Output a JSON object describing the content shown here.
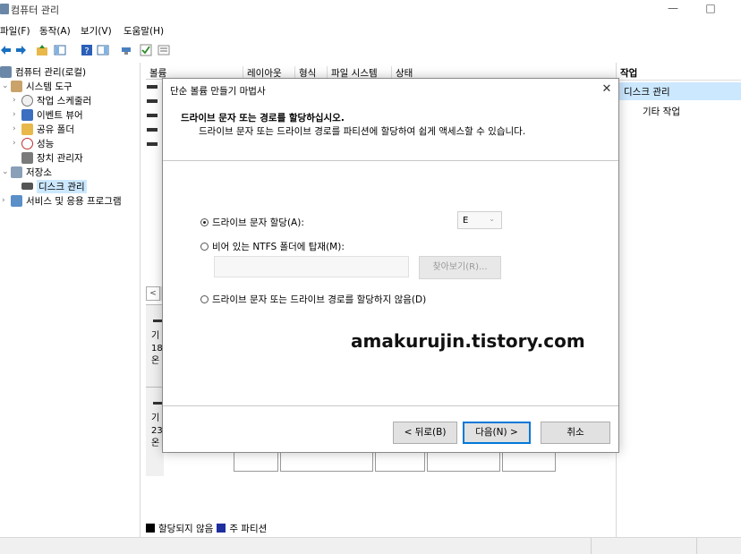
{
  "window": {
    "title": "컴퓨터 관리",
    "minimize_glyph": "—",
    "maximize_glyph": "□"
  },
  "menu": [
    "파일(F)",
    "동작(A)",
    "보기(V)",
    "도움말(H)"
  ],
  "toolbar_icons": [
    "back-arrow-icon",
    "forward-arrow-icon",
    "up-folder-icon",
    "console-tree-icon",
    "help-icon",
    "properties-icon",
    "connect-icon",
    "checkmark-icon",
    "grid-icon"
  ],
  "tree": [
    {
      "label": "컴퓨터 관리(로컬)",
      "icon": "computer-management-icon",
      "level": 0,
      "chevron": ""
    },
    {
      "label": "시스템 도구",
      "icon": "system-tools-icon",
      "level": 1,
      "chevron": "⌄"
    },
    {
      "label": "작업 스케줄러",
      "icon": "task-scheduler-icon",
      "level": 2,
      "chevron": "›"
    },
    {
      "label": "이벤트 뷰어",
      "icon": "event-viewer-icon",
      "level": 2,
      "chevron": "›"
    },
    {
      "label": "공유 폴더",
      "icon": "shared-folders-icon",
      "level": 2,
      "chevron": "›"
    },
    {
      "label": "성능",
      "icon": "performance-icon",
      "level": 2,
      "chevron": "›"
    },
    {
      "label": "장치 관리자",
      "icon": "device-manager-icon",
      "level": 2,
      "chevron": ""
    },
    {
      "label": "저장소",
      "icon": "storage-icon",
      "level": 1,
      "chevron": "⌄"
    },
    {
      "label": "디스크 관리",
      "icon": "disk-management-icon",
      "level": 2,
      "chevron": "",
      "selected": true
    },
    {
      "label": "서비스 및 응용 프로그램",
      "icon": "services-icon",
      "level": 1,
      "chevron": "›"
    }
  ],
  "columns": [
    "볼륨",
    "레이아웃",
    "형식",
    "파일 시스템",
    "상태"
  ],
  "disks": [
    {
      "lines": [
        "기",
        "18",
        "온"
      ]
    },
    {
      "lines": [
        "기",
        "23",
        "온"
      ]
    }
  ],
  "legend": [
    {
      "label": "할당되지 않음",
      "color": "#000000"
    },
    {
      "label": "주 파티션",
      "color": "#1f2fa0"
    }
  ],
  "actions": {
    "header": "작업",
    "selected": "디스크 관리",
    "other": "기타 작업"
  },
  "dialog": {
    "title": "단순 볼륨 만들기 마법사",
    "heading": "드라이브 문자 또는 경로를 할당하십시오.",
    "subheading": "드라이브 문자 또는 드라이브 경로를 파티션에 할당하여 쉽게 액세스할 수 있습니다.",
    "option_letter": "드라이브 문자 할당(A):",
    "option_folder": "비어 있는 NTFS 폴더에 탑재(M):",
    "option_none": "드라이브 문자 또는 드라이브 경로를 할당하지 않음(D)",
    "selected_letter": "E",
    "browse_label": "찾아보기(R)...",
    "back_label": "< 뒤로(B)",
    "next_label": "다음(N) >",
    "cancel_label": "취소",
    "close_glyph": "✕"
  },
  "watermark": "amakurujin.tistory.com",
  "colors": {
    "selection": "#cce8ff",
    "accent": "#0078d7"
  }
}
